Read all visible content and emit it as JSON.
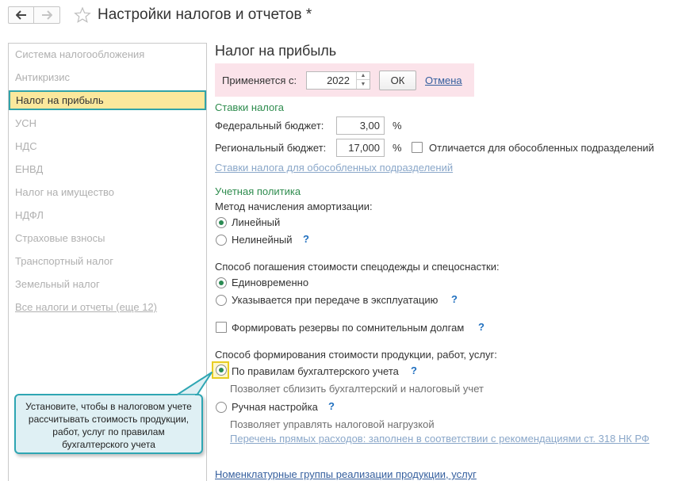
{
  "header": {
    "title": "Настройки налогов и отчетов *",
    "back_icon": "arrow-left-icon",
    "forward_icon": "arrow-right-icon",
    "favorite_icon": "star-icon"
  },
  "sidebar": {
    "items": [
      {
        "label": "Система налогообложения"
      },
      {
        "label": "Антикризис"
      },
      {
        "label": "Налог на прибыль",
        "active": true
      },
      {
        "label": "УСН"
      },
      {
        "label": "НДС"
      },
      {
        "label": "ЕНВД"
      },
      {
        "label": "Налог на имущество"
      },
      {
        "label": "НДФЛ"
      },
      {
        "label": "Страховые взносы"
      },
      {
        "label": "Транспортный налог"
      },
      {
        "label": "Земельный налог"
      },
      {
        "label": "Все налоги и отчеты (еще 12)"
      }
    ]
  },
  "main": {
    "title": "Налог на прибыль",
    "apply": {
      "label": "Применяется с:",
      "year": "2022",
      "ok_label": "ОК",
      "cancel_label": "Отмена"
    },
    "rates": {
      "title": "Ставки налога",
      "federal_label": "Федеральный бюджет:",
      "federal_value": "3,00",
      "regional_label": "Региональный бюджет:",
      "regional_value": "17,000",
      "percent": "%",
      "separate_label": "Отличается для обособленных подразделений",
      "separate_checked": false,
      "separate_link": "Ставки налога для обособленных подразделений"
    },
    "policy": {
      "title": "Учетная политика",
      "depreciation_label": "Метод начисления амортизации:",
      "depreciation_options": [
        "Линейный",
        "Нелинейный"
      ],
      "depreciation_selected": 0,
      "workwear_label": "Способ погашения стоимости спецодежды и спецоснастки:",
      "workwear_options": [
        "Единовременно",
        "Указывается при передаче в эксплуатацию"
      ],
      "workwear_selected": 0,
      "reserves_label": "Формировать резервы по сомнительным долгам",
      "reserves_checked": false,
      "cost_label": "Способ формирования стоимости продукции, работ, услуг:",
      "cost_options": [
        "По правилам бухгалтерского учета",
        "Ручная настройка"
      ],
      "cost_selected": 0,
      "cost_hint_1": "Позволяет сблизить бухгалтерский и налоговый учет",
      "cost_hint_2": "Позволяет управлять налоговой нагрузкой",
      "direct_costs_link": "Перечень прямых расходов: заполнен в соответствии с рекомендациями ст. 318 НК РФ",
      "nomenclature_link": "Номенклатурные группы реализации продукции, услуг",
      "help": "?"
    }
  },
  "callout": {
    "text": "Установите, чтобы в налоговом учете рассчитывать стоимость продукции, работ, услуг по правилам бухгалтерского учета"
  },
  "colors": {
    "active_bg": "#fbe89c",
    "active_border": "#31a3a8",
    "group_title": "#2e8c4e",
    "link": "#355f9e",
    "apply_bg": "#fbe3ea",
    "callout_bg": "#dff0f4",
    "callout_border": "#2ea6b3"
  }
}
